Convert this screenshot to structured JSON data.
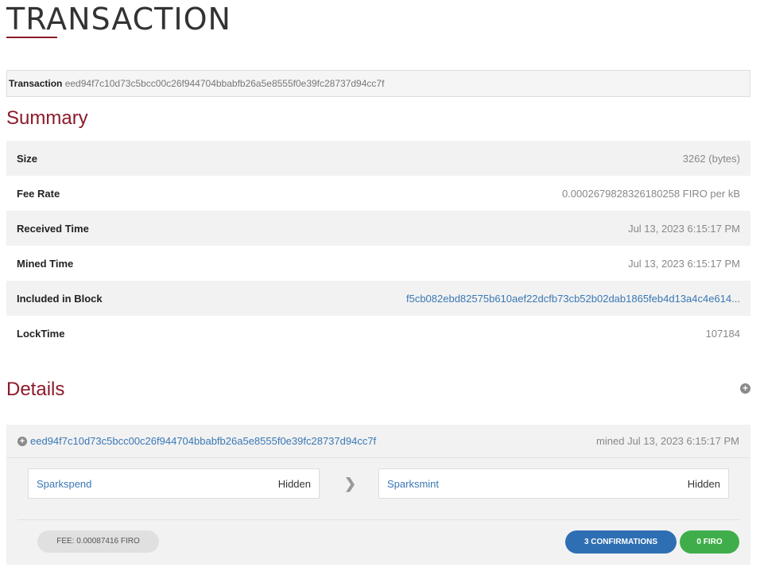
{
  "page": {
    "title": "TRANSACTION"
  },
  "transaction_bar": {
    "label": "Transaction",
    "hash": "eed94f7c10d73c5bcc00c26f944704bbabfb26a5e8555f0e39fc28737d94cc7f"
  },
  "summary": {
    "title": "Summary",
    "rows": [
      {
        "key": "Size",
        "value": "3262 (bytes)"
      },
      {
        "key": "Fee Rate",
        "value": "0.0002679828326180258 FIRO per kB"
      },
      {
        "key": "Received Time",
        "value": "Jul 13, 2023 6:15:17 PM"
      },
      {
        "key": "Mined Time",
        "value": "Jul 13, 2023 6:15:17 PM"
      },
      {
        "key": "Included in Block",
        "value": "f5cb082ebd82575b610aef22dcfb73cb52b02dab1865feb4d13a4c4e614..."
      },
      {
        "key": "LockTime",
        "value": "107184"
      }
    ]
  },
  "details": {
    "title": "Details",
    "expand_icon": "plus-circle-icon",
    "tx_hash": "eed94f7c10d73c5bcc00c26f944704bbabfb26a5e8555f0e39fc28737d94cc7f",
    "mined_text": "mined Jul 13, 2023 6:15:17 PM",
    "input": {
      "name": "Sparkspend",
      "amount": "Hidden"
    },
    "output": {
      "name": "Sparksmint",
      "amount": "Hidden"
    },
    "fee": "FEE: 0.00087416 FIRO",
    "confirmations": "3 CONFIRMATIONS",
    "amount": "0 FIRO"
  },
  "colors": {
    "accent": "#8b1a2b",
    "link": "#3a78b5",
    "confirmations": "#2e6fb4",
    "amount": "#3fae4a"
  }
}
